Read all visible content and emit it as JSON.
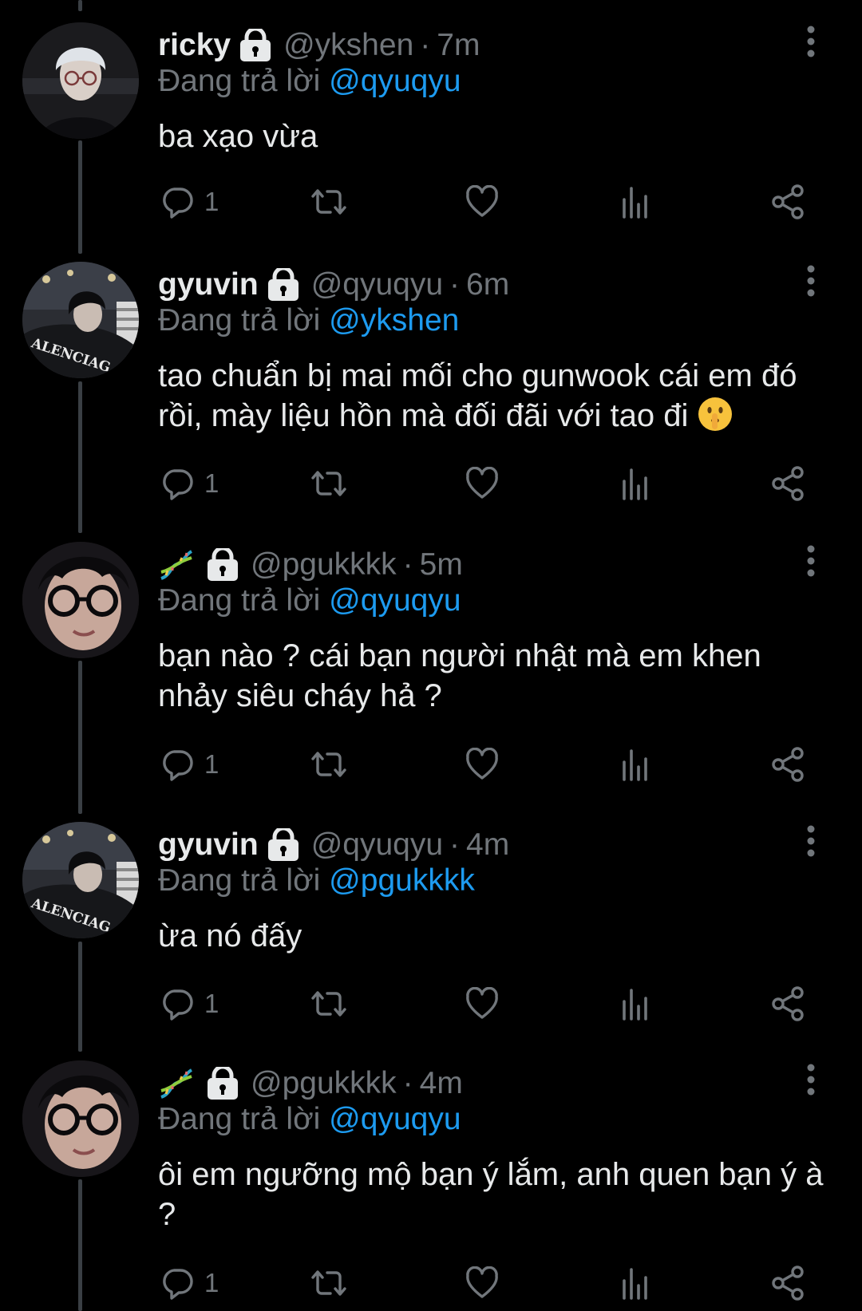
{
  "thread": {
    "tweets": [
      {
        "display_name": "ricky",
        "name_emoji": "",
        "locked": true,
        "handle": "@ykshen",
        "time": "7m",
        "replying_prefix": "Đang trả lời",
        "replying_to": "@qyuqyu",
        "text": "ba xạo vừa",
        "text_emoji": "",
        "reply_count": "1",
        "avatar": "avatar-ricky"
      },
      {
        "display_name": "gyuvin",
        "name_emoji": "",
        "locked": true,
        "handle": "@qyuqyu",
        "time": "6m",
        "replying_prefix": "Đang trả lời",
        "replying_to": "@ykshen",
        "text": "tao chuẩn bị mai mối cho gunwook cái em đó rồi, mày liệu hồn mà đối đãi với tao đi",
        "text_emoji": "shushing-face-emoji",
        "reply_count": "1",
        "avatar": "avatar-gyuvin"
      },
      {
        "display_name": "",
        "name_emoji": "dna-emoji",
        "locked": true,
        "handle": "@pgukkkk",
        "time": "5m",
        "replying_prefix": "Đang trả lời",
        "replying_to": "@qyuqyu",
        "text": "bạn nào ? cái bạn người nhật mà em khen nhảy siêu cháy hả ?",
        "text_emoji": "",
        "reply_count": "1",
        "avatar": "avatar-pgukkkk"
      },
      {
        "display_name": "gyuvin",
        "name_emoji": "",
        "locked": true,
        "handle": "@qyuqyu",
        "time": "4m",
        "replying_prefix": "Đang trả lời",
        "replying_to": "@pgukkkk",
        "text": "ừa nó đấy",
        "text_emoji": "",
        "reply_count": "1",
        "avatar": "avatar-gyuvin"
      },
      {
        "display_name": "",
        "name_emoji": "dna-emoji",
        "locked": true,
        "handle": "@pgukkkk",
        "time": "4m",
        "replying_prefix": "Đang trả lời",
        "replying_to": "@qyuqyu",
        "text": "ôi em ngưỡng mộ bạn ý lắm, anh quen bạn ý à ?",
        "text_emoji": "",
        "reply_count": "1",
        "avatar": "avatar-pgukkkk"
      }
    ]
  },
  "colors": {
    "background": "#000000",
    "text": "#e7e9ea",
    "muted": "#71767b",
    "link": "#1d9bf0",
    "thread_line": "#3a3f44"
  },
  "icons": {
    "reply": "reply-icon",
    "retweet": "retweet-icon",
    "like": "heart-icon",
    "views": "views-icon",
    "share": "share-icon",
    "more": "more-vertical-icon",
    "lock": "lock-icon"
  }
}
